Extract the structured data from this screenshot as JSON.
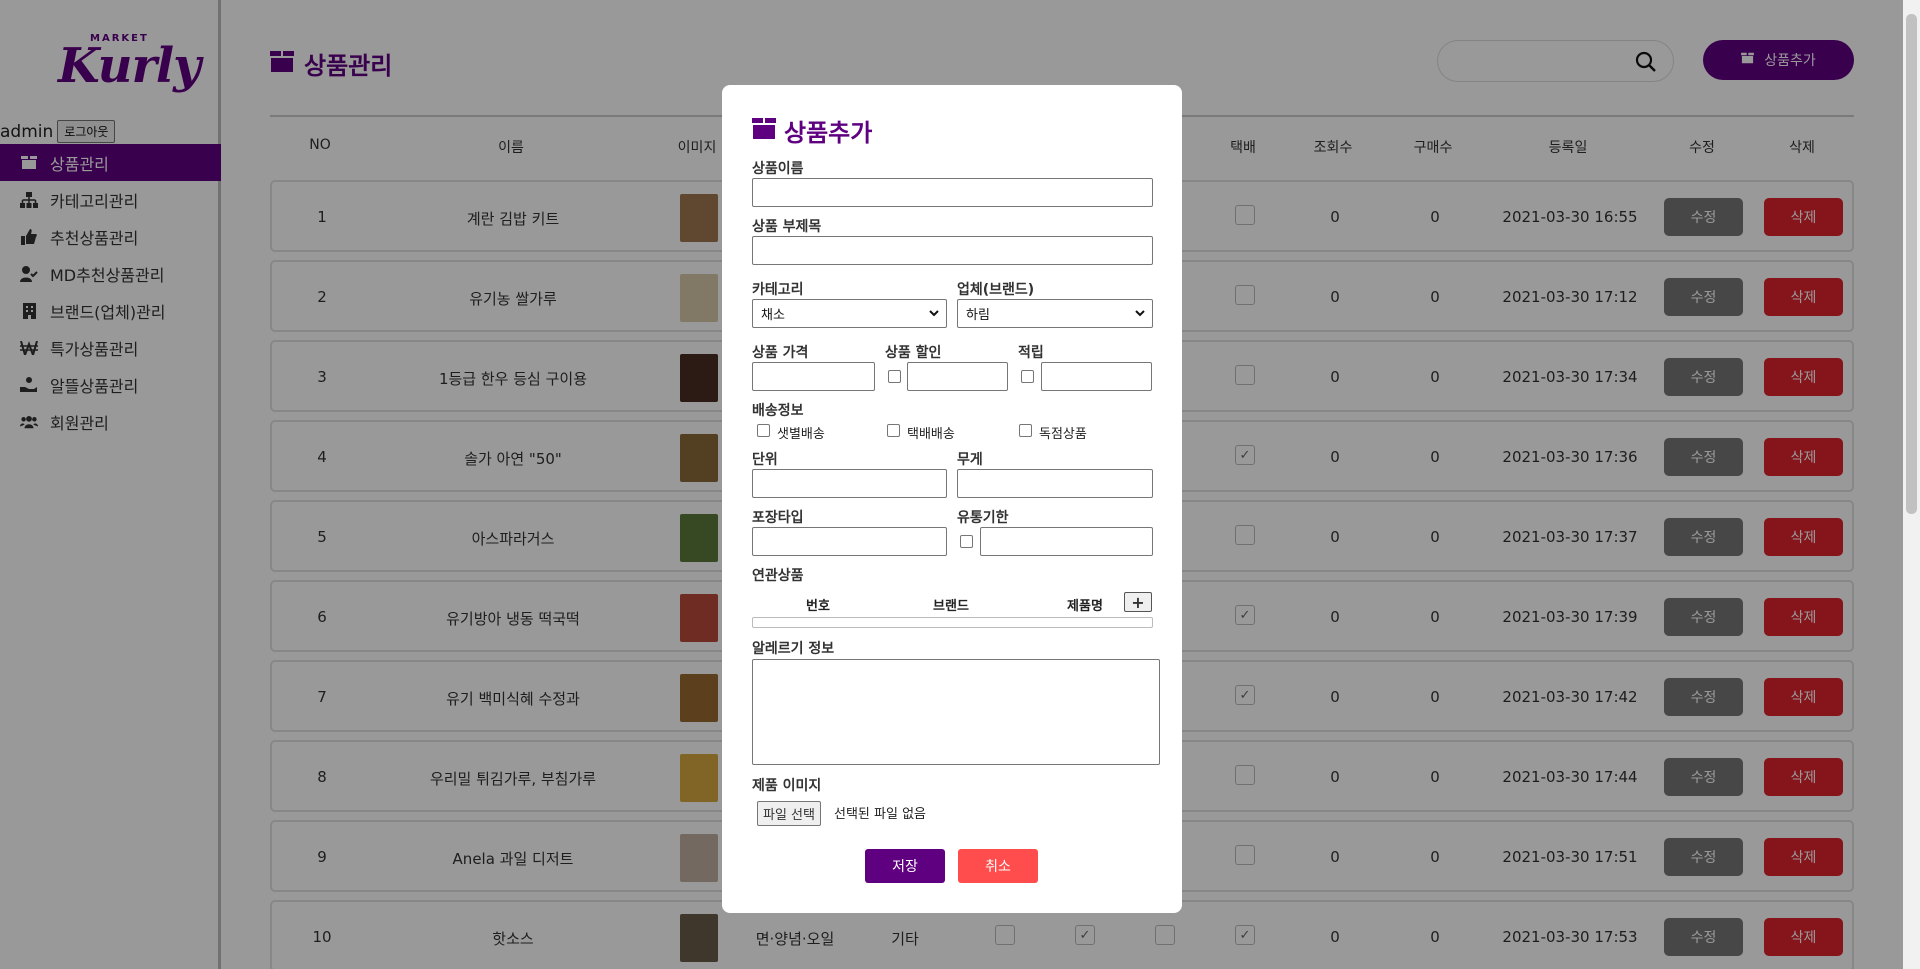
{
  "sidebar": {
    "logo_top": "MARKET",
    "logo_main": "Kurly",
    "user": "admin",
    "logout_label": "로그아웃",
    "items": [
      {
        "label": "상품관리",
        "icon": "box-icon",
        "active": true
      },
      {
        "label": "카테고리관리",
        "icon": "sitemap-icon"
      },
      {
        "label": "추천상품관리",
        "icon": "thumbs-up-icon"
      },
      {
        "label": "MD추천상품관리",
        "icon": "user-check-icon"
      },
      {
        "label": "브랜드(업체)관리",
        "icon": "building-icon"
      },
      {
        "label": "특가상품관리",
        "icon": "won-icon"
      },
      {
        "label": "알뜰상품관리",
        "icon": "hand-coin-icon"
      },
      {
        "label": "회원관리",
        "icon": "users-icon"
      }
    ]
  },
  "header": {
    "title": "상품관리",
    "search_placeholder": "",
    "add_button": "상품추가"
  },
  "table": {
    "columns": [
      "NO",
      "이름",
      "이미지",
      "택배",
      "조회수",
      "구매수",
      "등록일",
      "수정",
      "삭제"
    ],
    "edit_label": "수정",
    "delete_label": "삭제",
    "rows": [
      {
        "no": "1",
        "name": "계란 김밥 키트",
        "delivery": false,
        "views": "0",
        "purchases": "0",
        "date": "2021-03-30 16:55"
      },
      {
        "no": "2",
        "name": "유기농 쌀가루",
        "delivery": false,
        "views": "0",
        "purchases": "0",
        "date": "2021-03-30 17:12"
      },
      {
        "no": "3",
        "name": "1등급 한우 등심 구이용",
        "delivery": false,
        "views": "0",
        "purchases": "0",
        "date": "2021-03-30 17:34"
      },
      {
        "no": "4",
        "name": "솔가 아연 \"50\"",
        "delivery": true,
        "views": "0",
        "purchases": "0",
        "date": "2021-03-30 17:36"
      },
      {
        "no": "5",
        "name": "아스파라거스",
        "delivery": false,
        "views": "0",
        "purchases": "0",
        "date": "2021-03-30 17:37"
      },
      {
        "no": "6",
        "name": "유기방아 냉동 떡국떡",
        "delivery": true,
        "views": "0",
        "purchases": "0",
        "date": "2021-03-30 17:39"
      },
      {
        "no": "7",
        "name": "유기 백미식혜 수정과",
        "delivery": true,
        "views": "0",
        "purchases": "0",
        "date": "2021-03-30 17:42"
      },
      {
        "no": "8",
        "name": "우리밀 튀김가루, 부침가루",
        "delivery": false,
        "views": "0",
        "purchases": "0",
        "date": "2021-03-30 17:44"
      },
      {
        "no": "9",
        "name": "Anela 과일 디저트",
        "delivery": false,
        "views": "0",
        "purchases": "0",
        "date": "2021-03-30 17:51"
      },
      {
        "no": "10",
        "name": "핫소스",
        "category": "면·양념·오일",
        "brand": "기타",
        "delivery": true,
        "views": "0",
        "purchases": "0",
        "date": "2021-03-30 17:53"
      }
    ]
  },
  "modal": {
    "title": "상품추가",
    "name_label": "상품이름",
    "subtitle_label": "상품 부제목",
    "category_label": "카테고리",
    "category_value": "채소",
    "brand_label": "업체(브랜드)",
    "brand_value": "하림",
    "price_label": "상품 가격",
    "discount_label": "상품 할인",
    "points_label": "적립",
    "shipping_label": "배송정보",
    "shipping_options": [
      "샛별배송",
      "택배배송",
      "독점상품"
    ],
    "unit_label": "단위",
    "weight_label": "무게",
    "packaging_label": "포장타입",
    "expiry_label": "유통기한",
    "related_label": "연관상품",
    "related_columns": [
      "번호",
      "브랜드",
      "제품명"
    ],
    "add_related": "+",
    "allergy_label": "알레르기 정보",
    "image_label": "제품 이미지",
    "file_button": "파일 선택",
    "file_status": "선택된 파일 없음",
    "save": "저장",
    "cancel": "취소"
  },
  "colors": {
    "brand": "#5f0080",
    "delete": "#e0222e",
    "cancel": "#ff4c4c",
    "edit": "#777777"
  }
}
